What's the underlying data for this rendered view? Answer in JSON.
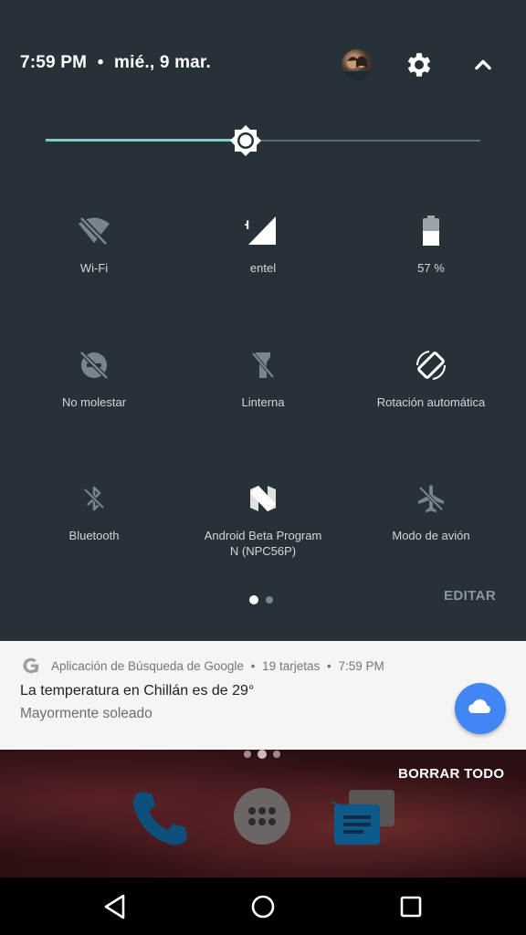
{
  "status": {
    "time": "7:59 PM",
    "separator": "•",
    "date": "mié., 9 mar."
  },
  "brightness": {
    "level": 0.46
  },
  "tiles": [
    {
      "label": "Wi-Fi",
      "icon": "wifi-off-icon"
    },
    {
      "label": "entel",
      "icon": "cell-signal-icon",
      "badge": "H"
    },
    {
      "label": "57 %",
      "icon": "battery-icon"
    },
    {
      "label": "No molestar",
      "icon": "do-not-disturb-off-icon"
    },
    {
      "label": "Linterna",
      "icon": "flashlight-off-icon"
    },
    {
      "label": "Rotación automática",
      "icon": "auto-rotate-icon"
    },
    {
      "label": "Bluetooth",
      "icon": "bluetooth-off-icon"
    },
    {
      "label": "Android Beta Program N (NPC56P)",
      "icon": "android-n-icon"
    },
    {
      "label": "Modo de avión",
      "icon": "airplane-off-icon"
    }
  ],
  "pager": {
    "current": 1,
    "total": 2
  },
  "edit_label": "EDITAR",
  "notification": {
    "app": "Aplicación de Búsqueda de Google",
    "cards": "19 tarjetas",
    "time": "7:59 PM",
    "sep": "•",
    "title": "La temperatura en Chillán es de 29°",
    "text": "Mayormente soleado",
    "action_icon": "cloud-icon",
    "colors": {
      "action": "#4285f4"
    }
  },
  "clear_all": "BORRAR TODO",
  "colors": {
    "panel": "#263238",
    "accent": "#80cbc4",
    "inactive": "#78868c"
  }
}
